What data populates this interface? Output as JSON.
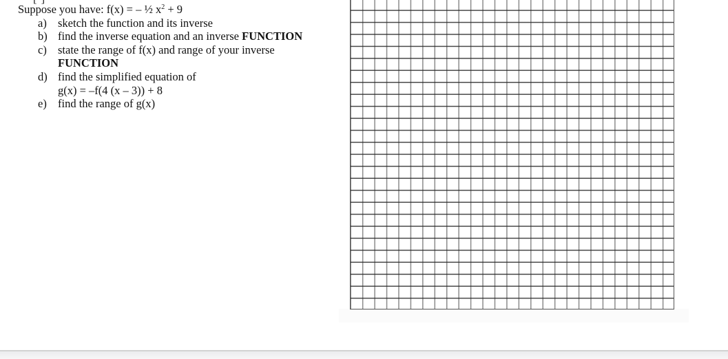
{
  "document": {
    "cutoff_fragment": "[ ]",
    "problem": {
      "intro_prefix": "Suppose you have: f(x) = – ½ x",
      "intro_exponent": "2",
      "intro_suffix": " + 9",
      "items": [
        {
          "label": "a)",
          "text": "sketch the function and its inverse"
        },
        {
          "label": "b)",
          "text": "find the inverse equation and an inverse ",
          "bold": "FUNCTION"
        },
        {
          "label": "c)",
          "text": "state the range of f(x) and range of your inverse",
          "bold_line2": "FUNCTION"
        },
        {
          "label": "d)",
          "text": "find the simplified equation of",
          "line2": "g(x) = –f(4 (x – 3)) + 8"
        },
        {
          "label": "e)",
          "text": "find the range of g(x)"
        }
      ]
    },
    "graph_paper": {
      "columns": 27,
      "rows_visible": 25
    }
  }
}
